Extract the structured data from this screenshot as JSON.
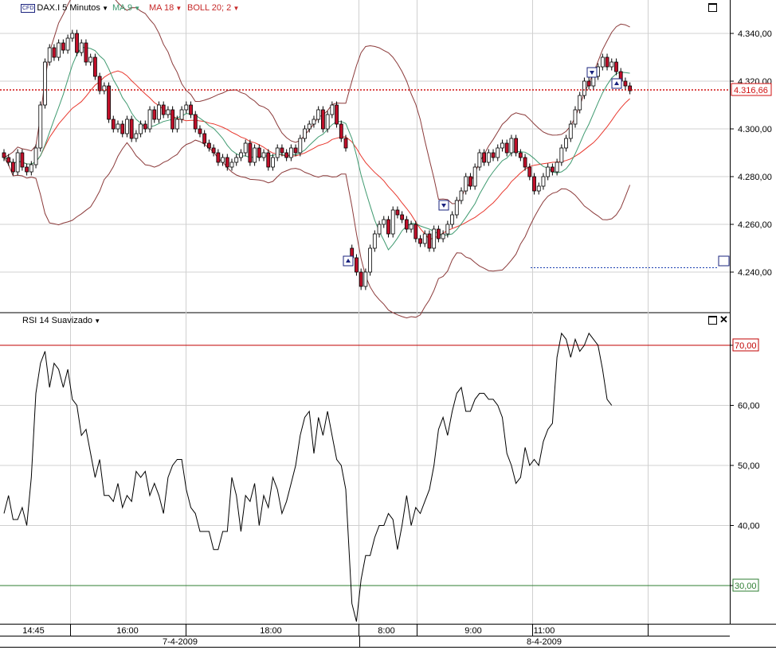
{
  "header": {
    "instrument": "DAX.I 5 Minutos",
    "ma9_label": "MA 9",
    "ma18_label": "MA 18",
    "boll_label": "BOLL 20; 2"
  },
  "rsi_header": {
    "label": "RSI 14 Suavizado"
  },
  "colors": {
    "candle_up": "#ffffff",
    "candle_down": "#c0102a",
    "ma9": "#3f9a70",
    "ma18": "#e8372d",
    "boll": "#8b3a3a",
    "rsi": "#000000",
    "last_price": "#d01010",
    "rsi_70": "#c00000",
    "rsi_30": "#2e7d32",
    "grid": "#d0d0d0"
  },
  "last_price_label": "4.316,66",
  "price_ticks": [
    "4.340,00",
    "4.320,00",
    "4.300,00",
    "4.280,00",
    "4.260,00",
    "4.240,00"
  ],
  "rsi_ticks": [
    "70,00",
    "60,00",
    "50,00",
    "40,00",
    "30,00"
  ],
  "time_labels": [
    "14:45",
    "16:00",
    "18:00",
    "8:00",
    "9:00",
    "11:00"
  ],
  "date_labels": [
    "7-4-2009",
    "8-4-2009"
  ],
  "chart_data": [
    {
      "type": "candlestick",
      "title": "DAX.I 5 Minutos",
      "ylim": [
        4222,
        4350
      ],
      "x": [
        "14:45",
        "16:00",
        "18:00",
        "8:00",
        "9:00",
        "11:00"
      ],
      "close": [
        4288,
        4286,
        4282,
        4290,
        4284,
        4282,
        4285,
        4292,
        4310,
        4328,
        4334,
        4330,
        4336,
        4333,
        4338,
        4340,
        4332,
        4336,
        4328,
        4330,
        4322,
        4316,
        4318,
        4304,
        4300,
        4302,
        4298,
        4304,
        4296,
        4298,
        4302,
        4300,
        4308,
        4304,
        4310,
        4306,
        4308,
        4300,
        4304,
        4308,
        4310,
        4306,
        4300,
        4298,
        4294,
        4292,
        4290,
        4286,
        4288,
        4284,
        4286,
        4288,
        4290,
        4294,
        4286,
        4292,
        4288,
        4290,
        4284,
        4288,
        4292,
        4290,
        4288,
        4292,
        4290,
        4296,
        4300,
        4302,
        4304,
        4308,
        4300,
        4306,
        4310,
        4302,
        4296,
        4292,
        4246,
        4240,
        4234,
        4240,
        4250,
        4256,
        4260,
        4262,
        4256,
        4266,
        4264,
        4262,
        4258,
        4260,
        4254,
        4252,
        4256,
        4250,
        4258,
        4254,
        4256,
        4260,
        4264,
        4270,
        4274,
        4280,
        4276,
        4284,
        4290,
        4286,
        4290,
        4288,
        4292,
        4294,
        4290,
        4296,
        4290,
        4288,
        4284,
        4280,
        4274,
        4276,
        4280,
        4284,
        4282,
        4286,
        4292,
        4296,
        4302,
        4308,
        4314,
        4320,
        4318,
        4322,
        4326,
        4330,
        4326,
        4328,
        4324,
        4320,
        4318,
        4316
      ],
      "open": [
        4290,
        4288,
        4286,
        4282,
        4290,
        4284,
        4282,
        4285,
        4292,
        4310,
        4328,
        4334,
        4330,
        4336,
        4333,
        4338,
        4340,
        4332,
        4336,
        4328,
        4330,
        4322,
        4316,
        4318,
        4304,
        4300,
        4302,
        4298,
        4304,
        4296,
        4298,
        4302,
        4300,
        4308,
        4304,
        4310,
        4306,
        4308,
        4300,
        4304,
        4308,
        4310,
        4306,
        4300,
        4298,
        4294,
        4292,
        4290,
        4286,
        4288,
        4284,
        4286,
        4288,
        4290,
        4294,
        4286,
        4292,
        4288,
        4290,
        4284,
        4288,
        4292,
        4290,
        4288,
        4292,
        4290,
        4296,
        4300,
        4302,
        4304,
        4308,
        4300,
        4306,
        4310,
        4302,
        4296,
        4250,
        4246,
        4240,
        4234,
        4240,
        4250,
        4256,
        4260,
        4262,
        4256,
        4266,
        4264,
        4262,
        4258,
        4260,
        4254,
        4252,
        4256,
        4250,
        4258,
        4254,
        4256,
        4260,
        4264,
        4270,
        4274,
        4280,
        4276,
        4284,
        4290,
        4286,
        4290,
        4288,
        4292,
        4294,
        4290,
        4296,
        4290,
        4288,
        4284,
        4280,
        4274,
        4276,
        4280,
        4284,
        4282,
        4286,
        4292,
        4296,
        4302,
        4308,
        4314,
        4320,
        4318,
        4322,
        4326,
        4330,
        4326,
        4328,
        4324,
        4320,
        4318
      ],
      "rsi_ylim": [
        22,
        77
      ],
      "rsi": [
        42,
        45,
        41,
        41,
        43,
        40,
        48,
        62,
        67,
        69,
        63,
        67,
        66,
        63,
        66,
        61,
        60,
        55,
        56,
        52,
        48,
        51,
        45,
        45,
        44,
        47,
        43,
        45,
        44,
        49,
        48,
        49,
        45,
        47,
        45,
        42,
        48,
        50,
        51,
        51,
        46,
        43,
        42,
        39,
        39,
        39,
        36,
        36,
        39,
        39,
        48,
        45,
        39,
        45,
        44,
        47,
        40,
        45,
        43,
        48,
        46,
        42,
        44,
        47,
        50,
        55,
        58,
        59,
        52,
        58,
        55,
        59,
        55,
        51,
        50,
        46,
        27,
        24,
        31,
        35,
        35,
        38,
        40,
        40,
        42,
        41,
        36,
        40,
        45,
        40,
        43,
        42,
        44,
        46,
        50,
        56,
        58,
        55,
        59,
        62,
        63,
        59,
        59,
        61,
        62,
        62,
        61,
        61,
        60,
        58,
        52,
        50,
        47,
        48,
        53,
        50,
        51,
        50,
        54,
        56,
        57,
        68,
        72,
        71,
        68,
        71,
        69,
        70,
        72,
        71,
        70,
        66,
        61,
        60
      ]
    }
  ]
}
